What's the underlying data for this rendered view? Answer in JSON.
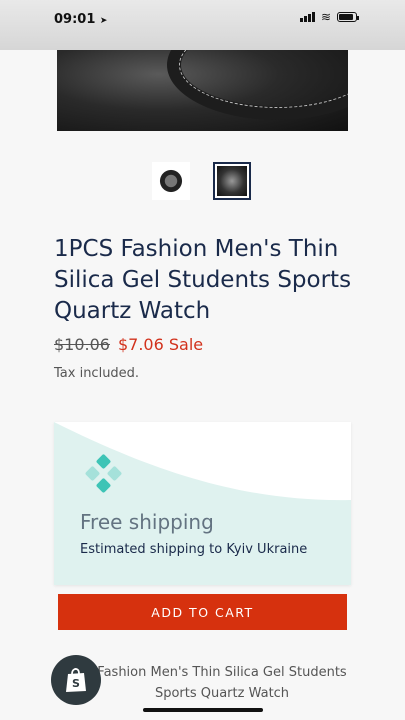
{
  "status_bar": {
    "time": "09:01",
    "battery_level": 0.85
  },
  "product": {
    "title": "1PCS Fashion Men's Thin Silica Gel Students Sports Quartz Watch",
    "price_original": "$10.06",
    "price_sale": "$7.06 Sale",
    "tax_note": "Tax included."
  },
  "shipping_card": {
    "title": "Free shipping",
    "subtitle": "Estimated shipping to Kyiv Ukraine",
    "accent_color": "#dff2ef",
    "logo_color": "#3ec4b6"
  },
  "cart": {
    "add_label": "ADD TO CART",
    "button_color": "#d6310e"
  },
  "footer": {
    "description": "Fashion Men's Thin Silica Gel Students Sports Quartz Watch"
  },
  "icons": [
    "location-arrow-icon",
    "signal-icon",
    "wifi-icon",
    "battery-icon",
    "shopify-bag-icon"
  ]
}
